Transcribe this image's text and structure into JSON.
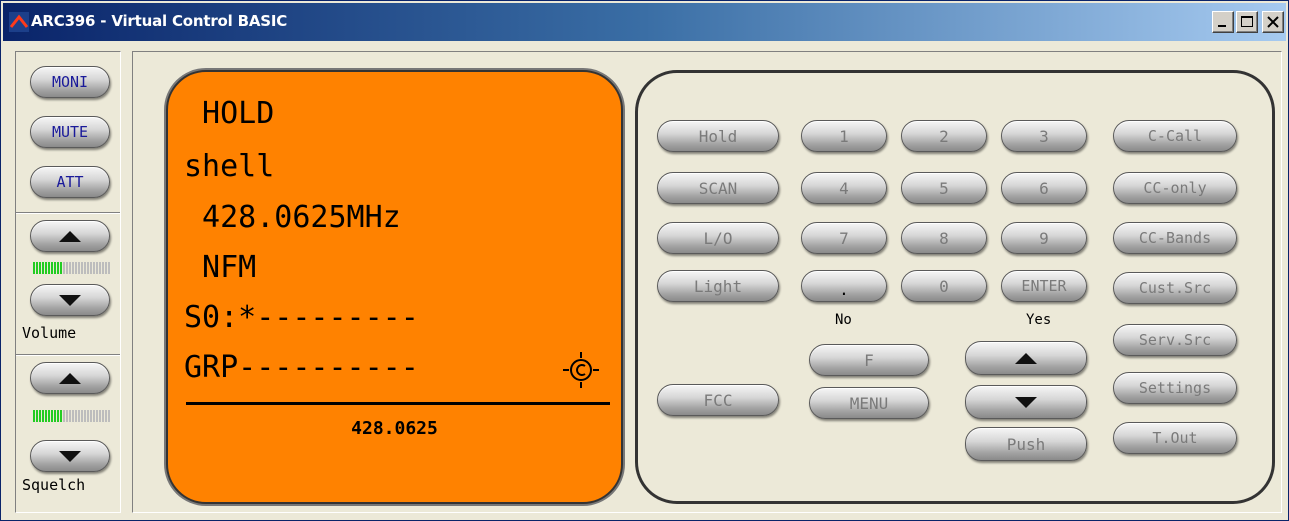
{
  "window": {
    "title": "ARC396 - Virtual Control BASIC",
    "minimize_label": "minimize",
    "maximize_label": "maximize",
    "close_label": "close"
  },
  "side": {
    "moni": "MONI",
    "mute": "MUTE",
    "att": "ATT",
    "volume_label": "Volume",
    "squelch_label": "Squelch",
    "volume_level": 0.38,
    "squelch_level": 0.38,
    "meter_on_color": "#22cc22",
    "meter_off_color": "#bdbdbd"
  },
  "display": {
    "line1": " HOLD",
    "line2": "shell",
    "line3": " 428.0625MHz",
    "line4": " NFM",
    "line5": "S0:*---------",
    "line6": "GRP----------",
    "frequency": "428.0625",
    "background_color": "#ff8200",
    "indicator_icon": "copyright-circle-icon"
  },
  "keypad": {
    "hold": "Hold",
    "scan": "SCAN",
    "lo": "L/O",
    "light": "Light",
    "fcc": "FCC",
    "k1": "1",
    "k2": "2",
    "k3": "3",
    "k4": "4",
    "k5": "5",
    "k6": "6",
    "k7": "7",
    "k8": "8",
    "k9": "9",
    "dot": ".",
    "k0": "0",
    "enter": "ENTER",
    "no_label": "No",
    "yes_label": "Yes",
    "f": "F",
    "menu": "MENU",
    "push": "Push",
    "c_call": "C-Call",
    "cc_only": "CC-only",
    "cc_bands": "CC-Bands",
    "cust_src": "Cust.Src",
    "serv_src": "Serv.Src",
    "settings": "Settings",
    "t_out": "T.Out"
  }
}
